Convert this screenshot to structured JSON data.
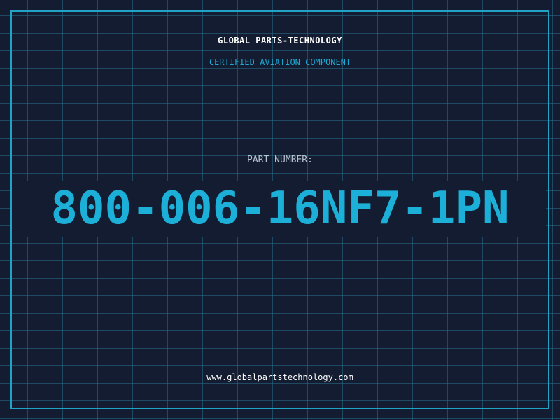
{
  "label": {
    "brand": "GLOBAL PARTS-TECHNOLOGY",
    "subtitle": "CERTIFIED AVIATION COMPONENT",
    "part_label": "PART NUMBER:",
    "part_number": "800-006-16NF7-1PN",
    "website": "www.globalpartstechnology.com"
  },
  "colors": {
    "background": "#131c30",
    "grid": "#286e8c",
    "accent": "#1cb0d8",
    "frame": "#21a3c6",
    "heading": "#ffffff",
    "muted": "#b6c2d0"
  }
}
